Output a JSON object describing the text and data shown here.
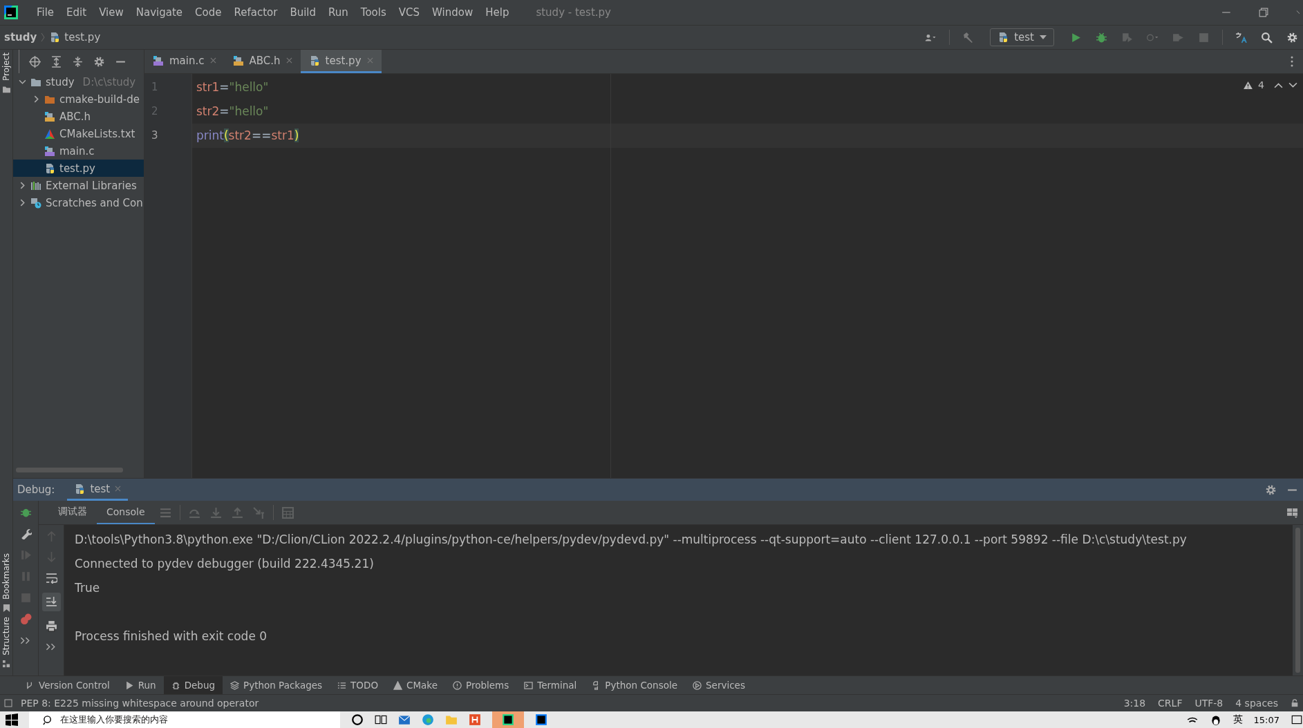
{
  "window": {
    "title": "study - test.py"
  },
  "menu": [
    "File",
    "Edit",
    "View",
    "Navigate",
    "Code",
    "Refactor",
    "Build",
    "Run",
    "Tools",
    "VCS",
    "Window",
    "Help"
  ],
  "breadcrumb": [
    "study",
    "test.py"
  ],
  "run_config": "test",
  "side_stripe": {
    "top": [
      "Project"
    ],
    "bottom": [
      "Bookmarks",
      "Structure"
    ]
  },
  "project_tree": [
    {
      "label": "study",
      "path": "D:\\c\\study",
      "kind": "folder",
      "expanded": true,
      "selected": false,
      "children": [
        {
          "label": "cmake-build-de",
          "kind": "build",
          "expanded": false,
          "selected": false
        },
        {
          "label": "ABC.h",
          "kind": "h",
          "selected": false
        },
        {
          "label": "CMakeLists.txt",
          "kind": "cmake",
          "selected": false
        },
        {
          "label": "main.c",
          "kind": "c",
          "selected": false
        },
        {
          "label": "test.py",
          "kind": "py",
          "selected": true
        }
      ]
    },
    {
      "label": "External Libraries",
      "kind": "libraries",
      "expanded": false,
      "selected": false
    },
    {
      "label": "Scratches and Con",
      "kind": "scratches",
      "expanded": false,
      "selected": false
    }
  ],
  "editor_tabs": [
    {
      "label": "main.c",
      "kind": "c",
      "selected": false
    },
    {
      "label": "ABC.h",
      "kind": "h",
      "selected": false
    },
    {
      "label": "test.py",
      "kind": "py",
      "selected": true
    }
  ],
  "editor": {
    "warning_count": "4",
    "lines": [
      {
        "number": "1",
        "current": false,
        "tokens": [
          {
            "text": "str1",
            "kind": "var"
          },
          {
            "text": "=",
            "kind": "op"
          },
          {
            "text": "\"hello\"",
            "kind": "str"
          }
        ]
      },
      {
        "number": "2",
        "current": false,
        "tokens": [
          {
            "text": "str2",
            "kind": "var"
          },
          {
            "text": "=",
            "kind": "op"
          },
          {
            "text": "\"hello\"",
            "kind": "str"
          }
        ]
      },
      {
        "number": "3",
        "current": true,
        "tokens": [
          {
            "text": "print",
            "kind": "fn"
          },
          {
            "text": "(",
            "kind": "paren"
          },
          {
            "text": "str2",
            "kind": "var"
          },
          {
            "text": "==",
            "kind": "op"
          },
          {
            "text": "str1",
            "kind": "var"
          },
          {
            "text": ")",
            "kind": "paren"
          }
        ]
      }
    ]
  },
  "debug": {
    "label": "Debug:",
    "tabs": [
      {
        "label": "test",
        "selected": true
      }
    ],
    "subtabs": [
      {
        "label": "调试器",
        "selected": false
      },
      {
        "label": "Console",
        "selected": true
      }
    ],
    "console": [
      {
        "text": "D:\\tools\\Python3.8\\python.exe \"D:/Clion/CLion 2022.2.4/plugins/python-ce/helpers/pydev/pydevd.py\" --multiprocess --qt-support=auto --client 127.0.0.1 --port 59892 --file D:\\c\\study\\test.py",
        "kind": "output"
      },
      {
        "text": "Connected to pydev debugger (build 222.4345.21)",
        "kind": "output"
      },
      {
        "text": "True",
        "kind": "output"
      },
      {
        "text": "Process finished with exit code 0",
        "kind": "exit"
      }
    ]
  },
  "tool_windows": [
    {
      "label": "Version Control",
      "kind": "vcs",
      "selected": false
    },
    {
      "label": "Run",
      "kind": "run",
      "selected": false
    },
    {
      "label": "Debug",
      "kind": "debug",
      "selected": true
    },
    {
      "label": "Python Packages",
      "kind": "packages",
      "selected": false
    },
    {
      "label": "TODO",
      "kind": "todo",
      "selected": false
    },
    {
      "label": "CMake",
      "kind": "cmake",
      "selected": false
    },
    {
      "label": "Problems",
      "kind": "problems",
      "selected": false
    },
    {
      "label": "Terminal",
      "kind": "terminal",
      "selected": false
    },
    {
      "label": "Python Console",
      "kind": "pyconsole",
      "selected": false
    },
    {
      "label": "Services",
      "kind": "services",
      "selected": false
    }
  ],
  "status_bar": {
    "message": "PEP 8: E225 missing whitespace around operator",
    "position": "3:18",
    "line_separator": "CRLF",
    "encoding": "UTF-8",
    "indent": "4 spaces"
  },
  "taskbar": {
    "search_placeholder": "在这里输入你要搜索的内容",
    "input_method": "英",
    "time": "15:07"
  }
}
